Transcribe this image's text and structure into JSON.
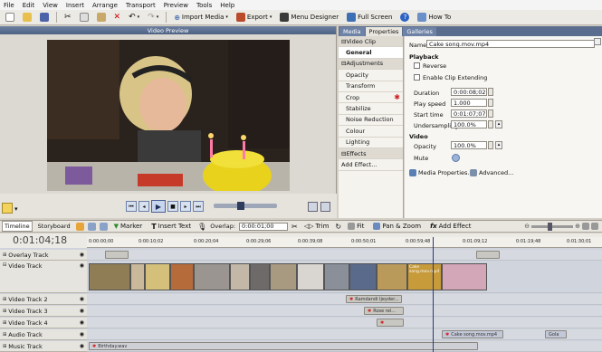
{
  "menu": [
    "File",
    "Edit",
    "View",
    "Insert",
    "Arrange",
    "Transport",
    "Preview",
    "Tools",
    "Help"
  ],
  "toolbar": {
    "import_media": "Import Media",
    "export": "Export",
    "menu_designer": "Menu Designer",
    "full_screen": "Full Screen",
    "how_to": "How To"
  },
  "preview": {
    "title": "Video Preview"
  },
  "props_tabs": [
    "Media",
    "Properties",
    "Galleries"
  ],
  "prop_list": {
    "video_clip": "Video Clip",
    "general": "General",
    "adjustments": "Adjustments",
    "items": [
      "Opacity",
      "Transform",
      "Crop",
      "Stabilize",
      "Noise Reduction",
      "Colour",
      "Lighting"
    ],
    "effects": "Effects",
    "add_effect": "Add Effect..."
  },
  "details": {
    "name_label": "Name",
    "name_value": "Cake song.mov.mp4",
    "playback": "Playback",
    "reverse": "Reverse",
    "enable_ext": "Enable Clip Extending",
    "duration_label": "Duration",
    "duration": "0:00:08;02",
    "speed_label": "Play speed",
    "speed": "1.000",
    "start_label": "Start time",
    "start": "0:01:07;07",
    "under_label": "Undersampling",
    "under": "100.0%",
    "video": "Video",
    "opacity_label": "Opacity",
    "opacity": "100.0%",
    "mute": "Mute",
    "media_props": "Media Properties...",
    "advanced": "Advanced..."
  },
  "timeline_bar": {
    "timeline": "Timeline",
    "storyboard": "Storyboard",
    "marker": "Marker",
    "insert_text": "Insert Text",
    "overlap_label": "Overlap:",
    "overlap": "0:00:01;00",
    "trim": "Trim",
    "fit": "Fit",
    "pan_zoom": "Pan & Zoom",
    "add_effect": "Add Effect"
  },
  "timecode": "0:01:04;18",
  "ruler_ticks": [
    "0:00:00;00",
    "0:00:10;02",
    "0:00:20;04",
    "0:00:29;06",
    "0:00:39;08",
    "0:00:50;01",
    "0:00:59;48",
    "0:01:09;12",
    "0:01:19;48",
    "0:01:30;01"
  ],
  "tracks": {
    "overlay": "Overlay Track",
    "video": "Video Track",
    "video2": "Video Track 2",
    "video3": "Video Track 3",
    "video4": "Video Track 4",
    "audio": "Audio Track",
    "music": "Music Track"
  },
  "clips": {
    "v2": "Ramdandi Ijeyder...",
    "v3": "Rose rel...",
    "audio1": "Cake song.mov.mp4",
    "audio2": "Gola",
    "music": "Birthday.wav",
    "cake_clip": "Cake song.mov.mp4"
  },
  "chart_colors": {
    "menu_bg": "#f4f4f4",
    "header": "#5a6d8e",
    "timeline": "#cfd3db"
  }
}
